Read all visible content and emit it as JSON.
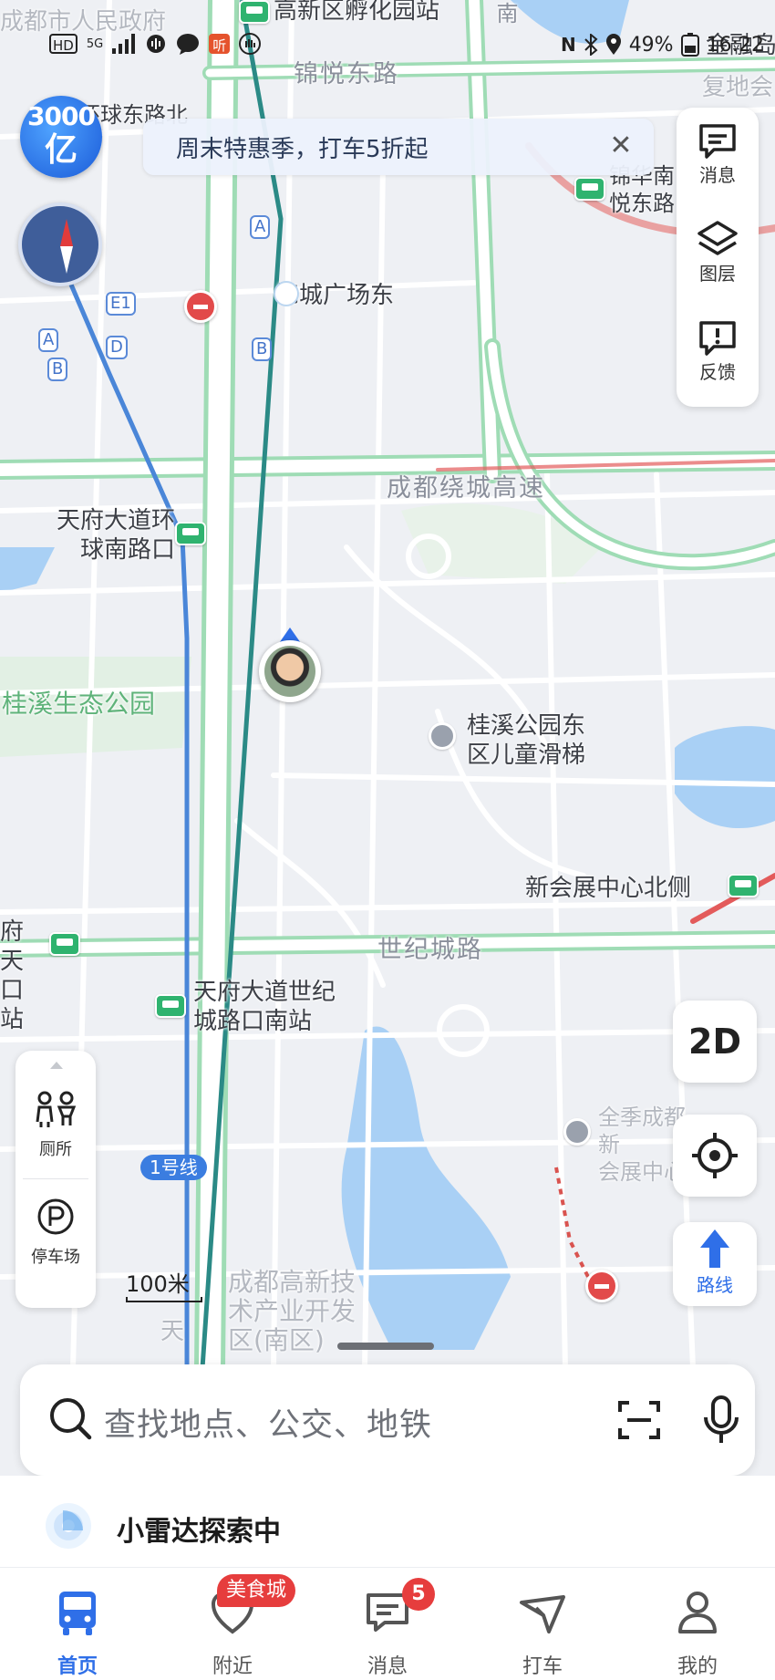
{
  "status_bar": {
    "left_icons": [
      "HD",
      "5G",
      "signal-icon",
      "audio-icon",
      "chat-icon",
      "听",
      "hand-icon"
    ],
    "battery": "49%",
    "time": "16:22"
  },
  "promo": {
    "text": "周末特惠季，打车5折起"
  },
  "logo": {
    "top": "3000",
    "bottom": "亿"
  },
  "right_panel": [
    {
      "label": "消息",
      "icon": "message-icon"
    },
    {
      "label": "图层",
      "icon": "layers-icon"
    },
    {
      "label": "反馈",
      "icon": "feedback-icon"
    }
  ],
  "map_labels": {
    "gov": "成都市人民政府",
    "incubator_station": "高新区孵化园站",
    "jinyue_road": "锦悦东路",
    "huanqiu_road": "环球东路北",
    "guangchang_east": "锦城广场东",
    "yuedong": "锦华南\n悦东路",
    "fu": "复地会",
    "jinrong": "金融岛",
    "ring_hwy": "成都绕城高速",
    "tianfu_ring_station": "天府大道环\n球南路口",
    "guixi_park": "桂溪生态公园",
    "slide": "桂溪公园东\n区儿童滑梯",
    "expo_north": "新会展中心北侧",
    "century_road": "世纪城路",
    "tianfu_century_station": "天府大道世纪\n城路口南站",
    "left_station": "府天\n口站",
    "hotel": "全季成都新\n会展中心",
    "hightech_zone": "成都高新技\n术产业开发\n区(南区)",
    "tian": "天",
    "south": "南",
    "line1": "1号线"
  },
  "badges": [
    "A",
    "E1",
    "A",
    "D",
    "B",
    "A",
    "B"
  ],
  "view_mode_button": "2D",
  "route_button": "路线",
  "left_panel": [
    {
      "label": "厕所",
      "icon": "toilet-icon"
    },
    {
      "label": "停车场",
      "icon": "parking-icon"
    }
  ],
  "scale": "100米",
  "search": {
    "placeholder": "查找地点、公交、地铁"
  },
  "radar": {
    "label": "小雷达探索中"
  },
  "nav": [
    {
      "label": "首页",
      "icon": "bus-icon",
      "active": true
    },
    {
      "label": "附近",
      "icon": "nearby-icon",
      "active": false
    },
    {
      "label": "消息",
      "icon": "message-icon",
      "active": false
    },
    {
      "label": "打车",
      "icon": "taxi-icon",
      "active": false
    },
    {
      "label": "我的",
      "icon": "profile-icon",
      "active": false
    }
  ],
  "nav_badges": {
    "nearby": "美食城",
    "messages": "5"
  },
  "colors": {
    "accent": "#2f6fe8",
    "metro_line": "#4a86d8",
    "green_road": "#2fb36f",
    "badge_red": "#e63d3d"
  }
}
